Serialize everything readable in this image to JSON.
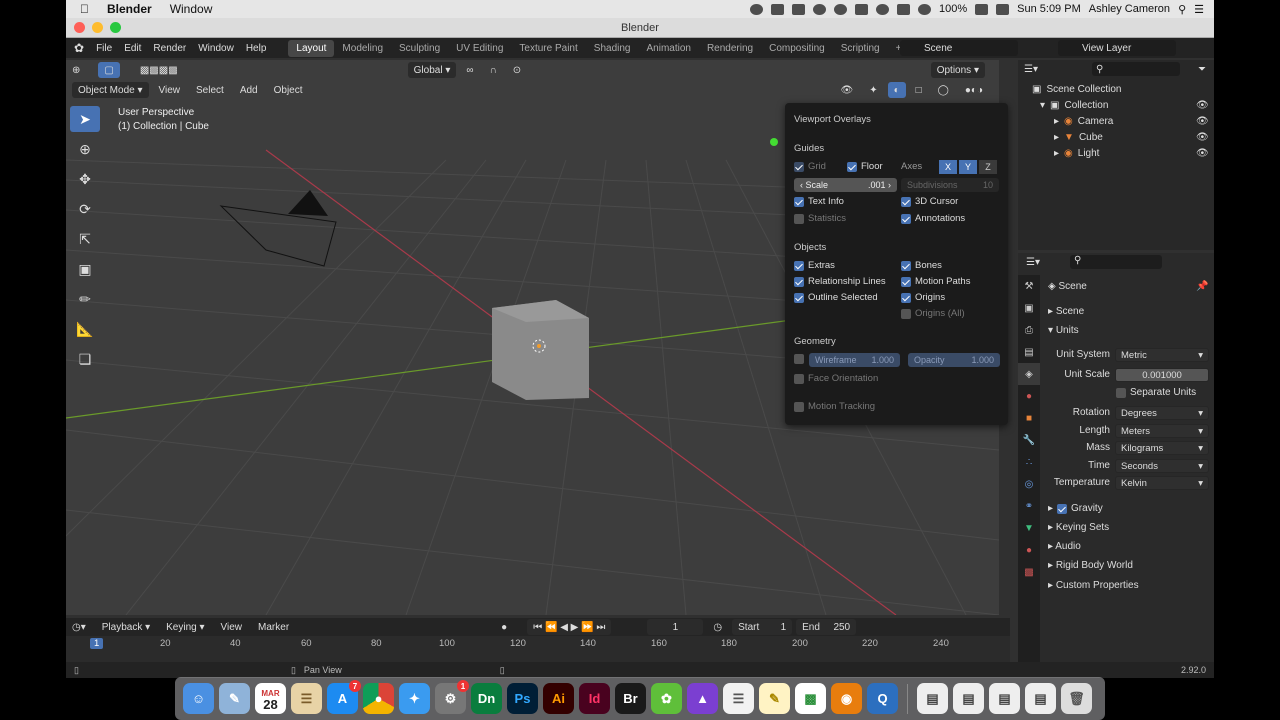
{
  "macbar": {
    "app": "Blender",
    "menu": "Window",
    "battery": "100%",
    "time": "Sun 5:09 PM",
    "user": "Ashley Cameron"
  },
  "window": {
    "title": "Blender"
  },
  "topbar": {
    "menus": [
      "File",
      "Edit",
      "Render",
      "Window",
      "Help"
    ],
    "workspaces": [
      "Layout",
      "Modeling",
      "Sculpting",
      "UV Editing",
      "Texture Paint",
      "Shading",
      "Animation",
      "Rendering",
      "Compositing",
      "Scripting"
    ],
    "active_workspace": "Layout",
    "scene": "Scene",
    "view_layer": "View Layer"
  },
  "viewport": {
    "transform": "Global",
    "options": "Options",
    "mode": "Object Mode",
    "menus": [
      "View",
      "Select",
      "Add",
      "Object"
    ],
    "info_line1": "User Perspective",
    "info_line2": "(1) Collection | Cube"
  },
  "overlays": {
    "title": "Viewport Overlays",
    "guides": {
      "label": "Guides",
      "grid": "Grid",
      "floor": "Floor",
      "axes": "Axes",
      "x": "X",
      "y": "Y",
      "z": "Z",
      "scale_label": "Scale",
      "scale_value": ".001",
      "subdiv_label": "Subdivisions",
      "subdiv_value": "10",
      "text_info": "Text Info",
      "cursor": "3D Cursor",
      "statistics": "Statistics",
      "annotations": "Annotations"
    },
    "objects": {
      "label": "Objects",
      "extras": "Extras",
      "bones": "Bones",
      "rel_lines": "Relationship Lines",
      "motion_paths": "Motion Paths",
      "outline": "Outline Selected",
      "origins": "Origins",
      "origins_all": "Origins (All)"
    },
    "geometry": {
      "label": "Geometry",
      "wireframe": "Wireframe",
      "wireframe_value": "1.000",
      "opacity": "Opacity",
      "opacity_value": "1.000",
      "face_orient": "Face Orientation"
    },
    "motion_tracking": "Motion Tracking"
  },
  "outliner": {
    "scene_collection": "Scene Collection",
    "collection": "Collection",
    "items": [
      "Camera",
      "Cube",
      "Light"
    ]
  },
  "properties": {
    "header": "Scene",
    "scene_panel": "Scene",
    "units_panel": "Units",
    "unit_system_label": "Unit System",
    "unit_system": "Metric",
    "unit_scale_label": "Unit Scale",
    "unit_scale": "0.001000",
    "separate_units": "Separate Units",
    "rotation_label": "Rotation",
    "rotation": "Degrees",
    "length_label": "Length",
    "length": "Meters",
    "mass_label": "Mass",
    "mass": "Kilograms",
    "time_label": "Time",
    "time": "Seconds",
    "temp_label": "Temperature",
    "temp": "Kelvin",
    "gravity": "Gravity",
    "keying_sets": "Keying Sets",
    "audio": "Audio",
    "rigid": "Rigid Body World",
    "custom": "Custom Properties"
  },
  "timeline": {
    "menus": [
      "Playback",
      "Keying",
      "View",
      "Marker"
    ],
    "current_frame": "1",
    "start_label": "Start",
    "start": "1",
    "end_label": "End",
    "end": "250",
    "ticks": [
      "1",
      "20",
      "40",
      "60",
      "80",
      "100",
      "120",
      "140",
      "160",
      "180",
      "200",
      "220",
      "240"
    ]
  },
  "status": {
    "center": "Pan View",
    "version": "2.92.0"
  },
  "dock": {
    "calendar_month": "MAR",
    "calendar_day": "28",
    "badges": [
      "7",
      "1"
    ],
    "apps": [
      "Dn",
      "Ps",
      "Ai",
      "Id",
      "Br"
    ]
  }
}
